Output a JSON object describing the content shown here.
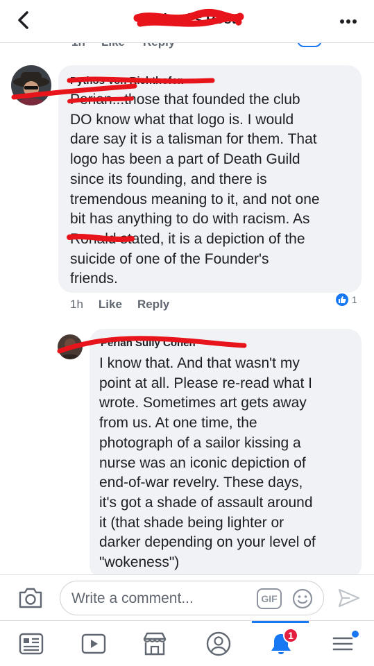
{
  "header": {
    "title": "Rachael's Post",
    "back_icon": "chevron-left-icon",
    "more_icon": "more-icon"
  },
  "prev_row": {
    "time": "1h",
    "like": "Like",
    "reply": "Reply"
  },
  "comments": [
    {
      "name": "Pythos Von Richthofen",
      "text": "Perian...those that founded the club\nDO know what that logo is.  I would\ndare say it is a talisman for them.  That\nlogo has been a part of Death Guild\nsince its founding, and there is\ntremendous meaning to it, and not one\nbit has anything to do with racism.  As\nRonald stated, it is a depiction of the\nsuicide of one of the Founder's\nfriends.",
      "time": "1h",
      "like_label": "Like",
      "reply_label": "Reply",
      "reaction_count": "1"
    },
    {
      "name": "Perian Sully Cohen",
      "text": "I know that. And that wasn't my\npoint at all. Please re-read what I\nwrote. Sometimes art gets away\nfrom us. At one time, the\nphotograph of a sailor kissing a\nnurse was an iconic depiction of\nend-of-war revelry. These days,\nit's got a shade of assault around\nit (that shade being lighter or\ndarker depending on your level of\n\"wokeness\")"
    }
  ],
  "composer": {
    "placeholder": "Write a comment...",
    "gif_label": "GIF"
  },
  "nav": {
    "items": [
      "news-feed-icon",
      "watch-icon",
      "marketplace-icon",
      "profile-icon",
      "notifications-icon",
      "menu-icon"
    ],
    "notification_count": "1"
  },
  "colors": {
    "accent": "#1877f2",
    "scribble": "#e8141b",
    "badge": "#e41e3f"
  }
}
